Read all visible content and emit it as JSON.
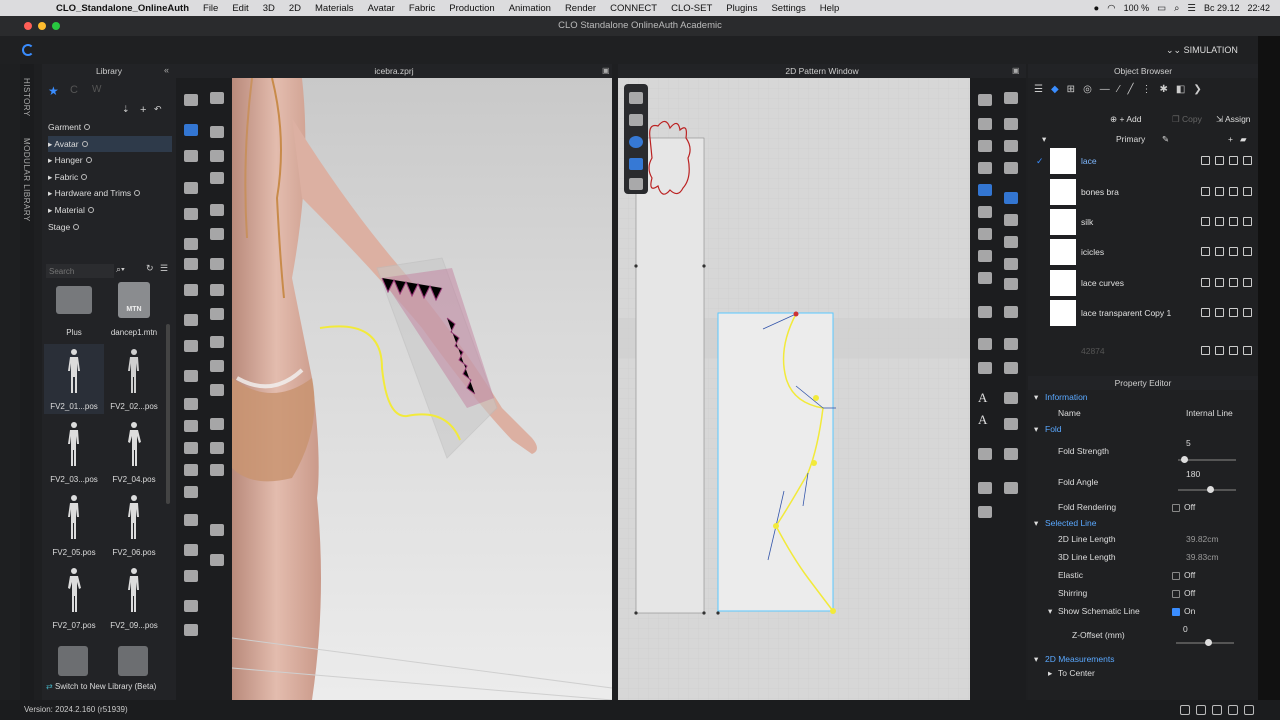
{
  "menubar": {
    "app": "CLO_Standalone_OnlineAuth",
    "items": [
      "File",
      "Edit",
      "3D",
      "2D",
      "Materials",
      "Avatar",
      "Fabric",
      "Production",
      "Animation",
      "Render",
      "CONNECT",
      "CLO-SET",
      "Plugins",
      "Settings",
      "Help"
    ],
    "battery": "100 %",
    "date": "Вс 29.12",
    "time": "22:42"
  },
  "window_title": "CLO Standalone OnlineAuth Academic",
  "toolbar": {
    "mode": "SIMULATION"
  },
  "left_tabs": {
    "history": "HISTORY",
    "modular": "MODULAR LIBRARY"
  },
  "library": {
    "title": "Library",
    "tree": [
      {
        "label": "Garment",
        "arrow": ""
      },
      {
        "label": "Avatar",
        "arrow": "▸"
      },
      {
        "label": "Hanger",
        "arrow": "▸"
      },
      {
        "label": "Fabric",
        "arrow": "▸"
      },
      {
        "label": "Hardware and Trims",
        "arrow": "▸"
      },
      {
        "label": "Material",
        "arrow": "▸"
      },
      {
        "label": "Stage",
        "arrow": ""
      }
    ],
    "search_placeholder": "Search",
    "thumbs": [
      {
        "label": "Plus",
        "kind": "folder"
      },
      {
        "label": "dancep1.mtn",
        "kind": "mtn",
        "badge": "MTN"
      },
      {
        "label": "FV2_01...pos",
        "kind": "fig"
      },
      {
        "label": "FV2_02...pos",
        "kind": "fig"
      },
      {
        "label": "FV2_03...pos",
        "kind": "fig"
      },
      {
        "label": "FV2_04.pos",
        "kind": "fig"
      },
      {
        "label": "FV2_05.pos",
        "kind": "fig"
      },
      {
        "label": "FV2_06.pos",
        "kind": "fig"
      },
      {
        "label": "FV2_07.pos",
        "kind": "fig"
      },
      {
        "label": "FV2_09...pos",
        "kind": "fig"
      }
    ],
    "switch_label": "Switch to New Library (Beta)"
  },
  "view3d": {
    "title": "icebra.zprj"
  },
  "view2d": {
    "title": "2D Pattern Window"
  },
  "object_browser": {
    "title": "Object Browser",
    "add_label": "Add",
    "copy_label": "Copy",
    "assign_label": "Assign",
    "group": "Primary",
    "fabrics": [
      {
        "name": "lace",
        "selected": true
      },
      {
        "name": "bones bra",
        "selected": false
      },
      {
        "name": "silk",
        "selected": false
      },
      {
        "name": "icicles",
        "selected": false
      },
      {
        "name": "lace curves",
        "selected": false
      },
      {
        "name": "lace transparent Copy 1",
        "selected": false
      }
    ],
    "extra": "42874"
  },
  "property_editor": {
    "title": "Property Editor",
    "information": "Information",
    "name_label": "Name",
    "name_value": "Internal Line",
    "fold": "Fold",
    "fold_strength_label": "Fold Strength",
    "fold_strength": "5",
    "fold_strength_level": 0.05,
    "fold_angle_label": "Fold Angle",
    "fold_angle": "180",
    "fold_angle_level": 0.5,
    "fold_rendering_label": "Fold Rendering",
    "fold_rendering": "Off",
    "selected_line": "Selected Line",
    "len2d_label": "2D Line Length",
    "len2d": "39.82cm",
    "len3d_label": "3D Line Length",
    "len3d": "39.83cm",
    "elastic_label": "Elastic",
    "elastic": "Off",
    "shirring_label": "Shirring",
    "shirring": "Off",
    "schematic_label": "Show Schematic Line",
    "schematic": "On",
    "zoffset_label": "Z-Offset (mm)",
    "zoffset": "0",
    "zoffset_level": 0.5,
    "measurements": "2D Measurements",
    "to_center": "To Center"
  },
  "status": {
    "version": "Version: 2024.2.160 (r51939)"
  }
}
